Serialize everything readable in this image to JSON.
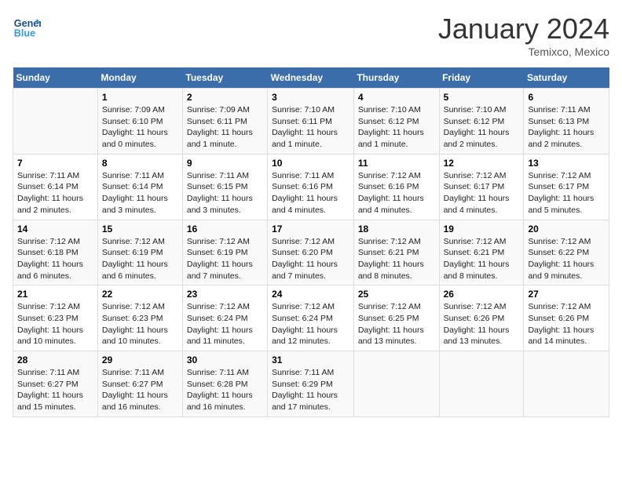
{
  "header": {
    "logo_line1": "General",
    "logo_line2": "Blue",
    "month": "January 2024",
    "location": "Temixco, Mexico"
  },
  "days": [
    "Sunday",
    "Monday",
    "Tuesday",
    "Wednesday",
    "Thursday",
    "Friday",
    "Saturday"
  ],
  "weeks": [
    [
      {
        "num": "",
        "info": ""
      },
      {
        "num": "1",
        "info": "Sunrise: 7:09 AM\nSunset: 6:10 PM\nDaylight: 11 hours\nand 0 minutes."
      },
      {
        "num": "2",
        "info": "Sunrise: 7:09 AM\nSunset: 6:11 PM\nDaylight: 11 hours\nand 1 minute."
      },
      {
        "num": "3",
        "info": "Sunrise: 7:10 AM\nSunset: 6:11 PM\nDaylight: 11 hours\nand 1 minute."
      },
      {
        "num": "4",
        "info": "Sunrise: 7:10 AM\nSunset: 6:12 PM\nDaylight: 11 hours\nand 1 minute."
      },
      {
        "num": "5",
        "info": "Sunrise: 7:10 AM\nSunset: 6:12 PM\nDaylight: 11 hours\nand 2 minutes."
      },
      {
        "num": "6",
        "info": "Sunrise: 7:11 AM\nSunset: 6:13 PM\nDaylight: 11 hours\nand 2 minutes."
      }
    ],
    [
      {
        "num": "7",
        "info": "Sunrise: 7:11 AM\nSunset: 6:14 PM\nDaylight: 11 hours\nand 2 minutes."
      },
      {
        "num": "8",
        "info": "Sunrise: 7:11 AM\nSunset: 6:14 PM\nDaylight: 11 hours\nand 3 minutes."
      },
      {
        "num": "9",
        "info": "Sunrise: 7:11 AM\nSunset: 6:15 PM\nDaylight: 11 hours\nand 3 minutes."
      },
      {
        "num": "10",
        "info": "Sunrise: 7:11 AM\nSunset: 6:16 PM\nDaylight: 11 hours\nand 4 minutes."
      },
      {
        "num": "11",
        "info": "Sunrise: 7:12 AM\nSunset: 6:16 PM\nDaylight: 11 hours\nand 4 minutes."
      },
      {
        "num": "12",
        "info": "Sunrise: 7:12 AM\nSunset: 6:17 PM\nDaylight: 11 hours\nand 4 minutes."
      },
      {
        "num": "13",
        "info": "Sunrise: 7:12 AM\nSunset: 6:17 PM\nDaylight: 11 hours\nand 5 minutes."
      }
    ],
    [
      {
        "num": "14",
        "info": "Sunrise: 7:12 AM\nSunset: 6:18 PM\nDaylight: 11 hours\nand 6 minutes."
      },
      {
        "num": "15",
        "info": "Sunrise: 7:12 AM\nSunset: 6:19 PM\nDaylight: 11 hours\nand 6 minutes."
      },
      {
        "num": "16",
        "info": "Sunrise: 7:12 AM\nSunset: 6:19 PM\nDaylight: 11 hours\nand 7 minutes."
      },
      {
        "num": "17",
        "info": "Sunrise: 7:12 AM\nSunset: 6:20 PM\nDaylight: 11 hours\nand 7 minutes."
      },
      {
        "num": "18",
        "info": "Sunrise: 7:12 AM\nSunset: 6:21 PM\nDaylight: 11 hours\nand 8 minutes."
      },
      {
        "num": "19",
        "info": "Sunrise: 7:12 AM\nSunset: 6:21 PM\nDaylight: 11 hours\nand 8 minutes."
      },
      {
        "num": "20",
        "info": "Sunrise: 7:12 AM\nSunset: 6:22 PM\nDaylight: 11 hours\nand 9 minutes."
      }
    ],
    [
      {
        "num": "21",
        "info": "Sunrise: 7:12 AM\nSunset: 6:23 PM\nDaylight: 11 hours\nand 10 minutes."
      },
      {
        "num": "22",
        "info": "Sunrise: 7:12 AM\nSunset: 6:23 PM\nDaylight: 11 hours\nand 10 minutes."
      },
      {
        "num": "23",
        "info": "Sunrise: 7:12 AM\nSunset: 6:24 PM\nDaylight: 11 hours\nand 11 minutes."
      },
      {
        "num": "24",
        "info": "Sunrise: 7:12 AM\nSunset: 6:24 PM\nDaylight: 11 hours\nand 12 minutes."
      },
      {
        "num": "25",
        "info": "Sunrise: 7:12 AM\nSunset: 6:25 PM\nDaylight: 11 hours\nand 13 minutes."
      },
      {
        "num": "26",
        "info": "Sunrise: 7:12 AM\nSunset: 6:26 PM\nDaylight: 11 hours\nand 13 minutes."
      },
      {
        "num": "27",
        "info": "Sunrise: 7:12 AM\nSunset: 6:26 PM\nDaylight: 11 hours\nand 14 minutes."
      }
    ],
    [
      {
        "num": "28",
        "info": "Sunrise: 7:11 AM\nSunset: 6:27 PM\nDaylight: 11 hours\nand 15 minutes."
      },
      {
        "num": "29",
        "info": "Sunrise: 7:11 AM\nSunset: 6:27 PM\nDaylight: 11 hours\nand 16 minutes."
      },
      {
        "num": "30",
        "info": "Sunrise: 7:11 AM\nSunset: 6:28 PM\nDaylight: 11 hours\nand 16 minutes."
      },
      {
        "num": "31",
        "info": "Sunrise: 7:11 AM\nSunset: 6:29 PM\nDaylight: 11 hours\nand 17 minutes."
      },
      {
        "num": "",
        "info": ""
      },
      {
        "num": "",
        "info": ""
      },
      {
        "num": "",
        "info": ""
      }
    ]
  ]
}
